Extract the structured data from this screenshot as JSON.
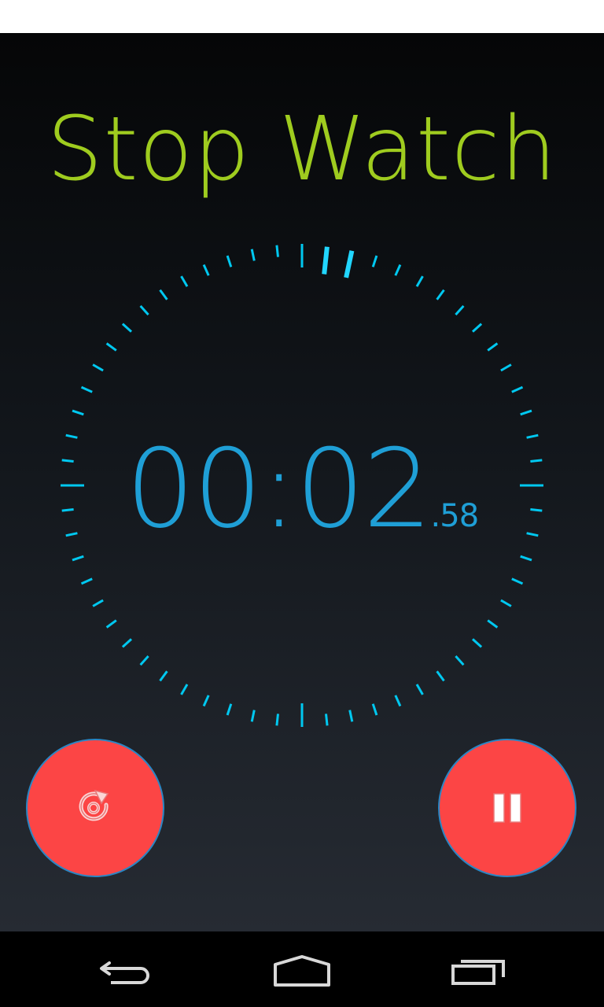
{
  "app": {
    "title": "Stop Watch",
    "accent_color": "#9fcc1f",
    "dial_color": "#00c8f0",
    "time_color": "#1f9fd6",
    "button_color": "#fc4545"
  },
  "timer": {
    "main": "00:02",
    "fraction": ".58",
    "tick_count": 60,
    "current_seconds": 2.58
  },
  "controls": {
    "reset_icon": "reset-icon",
    "pause_icon": "pause-icon"
  },
  "navigation": {
    "back_icon": "back-icon",
    "home_icon": "home-icon",
    "recents_icon": "recents-icon"
  }
}
